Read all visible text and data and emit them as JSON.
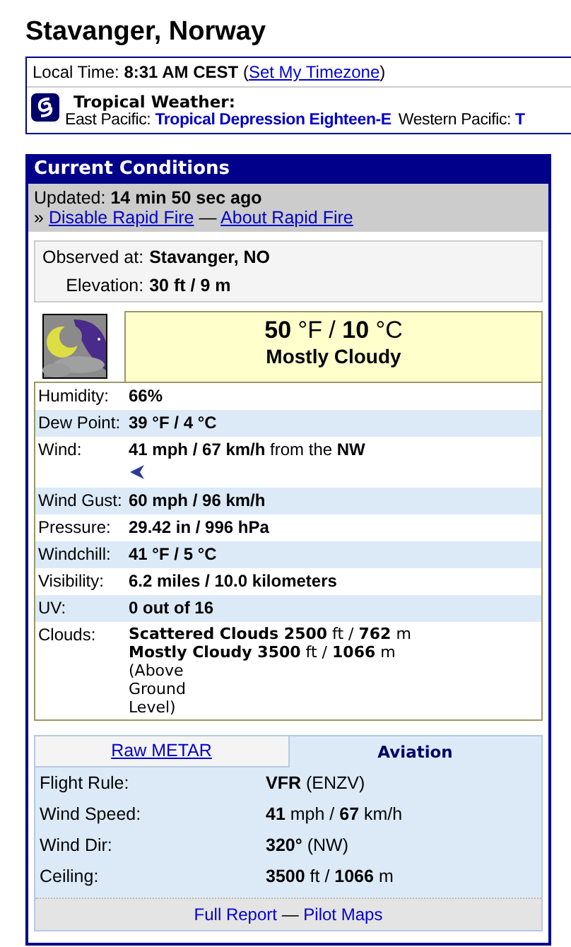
{
  "page_title": "Stavanger, Norway",
  "local_time": {
    "label": "Local Time:",
    "value": "8:31 AM CEST",
    "open": "(",
    "link": "Set My Timezone",
    "close": ")"
  },
  "tropical": {
    "title": "Tropical Weather:",
    "regions": [
      {
        "label": "East Pacific:",
        "link": "Tropical Depression Eighteen-E"
      },
      {
        "label": "Western Pacific:",
        "link": "T"
      }
    ]
  },
  "panel": {
    "title": "Current Conditions",
    "updated_label": "Updated:",
    "updated_value": "14 min 50 sec ago",
    "links_prefix": "»",
    "links": [
      "Disable Rapid Fire",
      "About Rapid Fire"
    ],
    "links_separator": "—",
    "station": [
      {
        "label": "Observed at:",
        "value": "Stavanger, NO"
      },
      {
        "label": "Elevation:",
        "value": "30 ft / 9 m"
      }
    ],
    "temperature": "**50** °F / **10** °C",
    "condition": "Mostly Cloudy",
    "rows": [
      {
        "label": "Humidity:",
        "value": "66%",
        "kind": "plain"
      },
      {
        "label": "Dew Point:",
        "value": "39 °F / 4 °C",
        "kind": "plain"
      },
      {
        "label": "Wind:",
        "value": "**41 mph / 67 km/h** from the **NW**",
        "kind": "wind"
      },
      {
        "label": "Wind Gust:",
        "value": "**60 mph / 96 km/h**",
        "kind": "plain"
      },
      {
        "label": "Pressure:",
        "value": "29.42 in / 996 hPa",
        "kind": "plain"
      },
      {
        "label": "Windchill:",
        "value": "41 °F / 5 °C",
        "kind": "plain"
      },
      {
        "label": "Visibility:",
        "value": "6.2 miles / 10.0 kilometers",
        "kind": "plain"
      },
      {
        "label": "UV:",
        "value": "**0** out of 16",
        "kind": "plain"
      },
      {
        "label": "Clouds:",
        "kind": "clouds",
        "lines": [
          "**Scattered Clouds 2500** ft / **762** m",
          "**Mostly Cloudy 3500** ft / **1066** m",
          "(Above",
          "Ground",
          "Level)"
        ]
      }
    ],
    "tabs": [
      {
        "label": "Raw METAR",
        "selected": false
      },
      {
        "label": "Aviation",
        "selected": true
      }
    ],
    "aviation": [
      {
        "label": "Flight Rule:",
        "value": "**VFR** (ENZV)"
      },
      {
        "label": "Wind Speed:",
        "value": "**41** mph / **67** km/h"
      },
      {
        "label": "Wind Dir:",
        "value": "**320°** (NW)"
      },
      {
        "label": "Ceiling:",
        "value": "**3500** ft / **1066** m"
      }
    ],
    "footer_links": [
      "Full Report",
      "Pilot Maps"
    ],
    "footer_separator": "—"
  }
}
